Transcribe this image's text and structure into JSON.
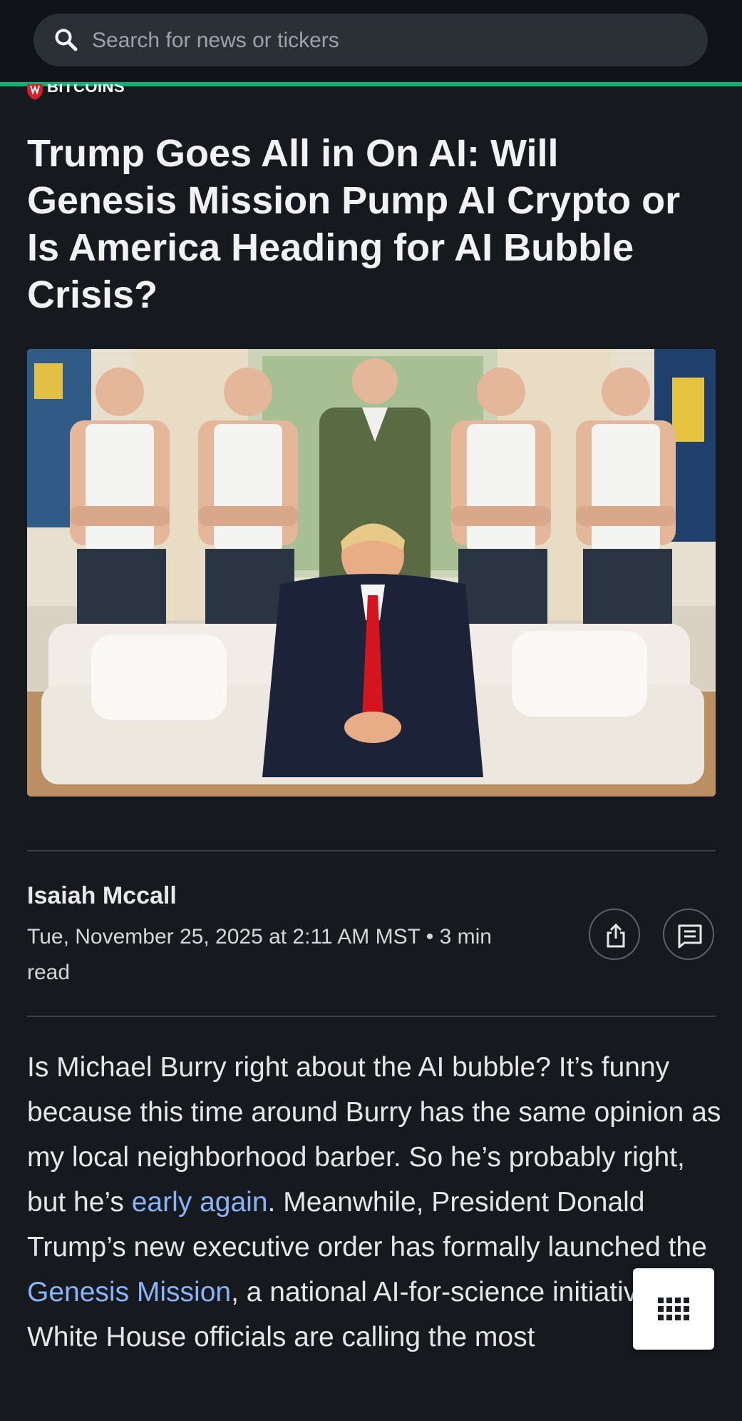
{
  "search": {
    "placeholder": "Search for news or tickers"
  },
  "colors": {
    "accent_line": "#0fb274",
    "link": "#8ab4f8",
    "background": "#16191e"
  },
  "article": {
    "provider": "BITCOINS",
    "title": "Trump Goes All in On AI: Will Genesis Mission Pump AI Crypto or Is America Heading for AI Bubble Crisis?",
    "author": "Isaiah Mccall",
    "byline": "Tue, November 25, 2025 at 2:11 AM MST • 3 min read",
    "body": {
      "part1": "Is Michael Burry right about the AI bubble? It’s funny because this time around Burry has the same opinion as my local neighborhood barber. So he’s probably right, but he’s ",
      "link1": "early again",
      "part2": ". Meanwhile, President Donald Trump’s new executive order has formally launched the ",
      "link2": "Genesis Mission",
      "part3": ", a national AI-for-science initiative the White House officials are calling the most"
    }
  },
  "icons": {
    "search": "search-icon",
    "share": "share-icon",
    "comments": "comment-icon",
    "menu": "grid-menu-icon",
    "provider_logo": "bitcoins-logo-icon"
  }
}
